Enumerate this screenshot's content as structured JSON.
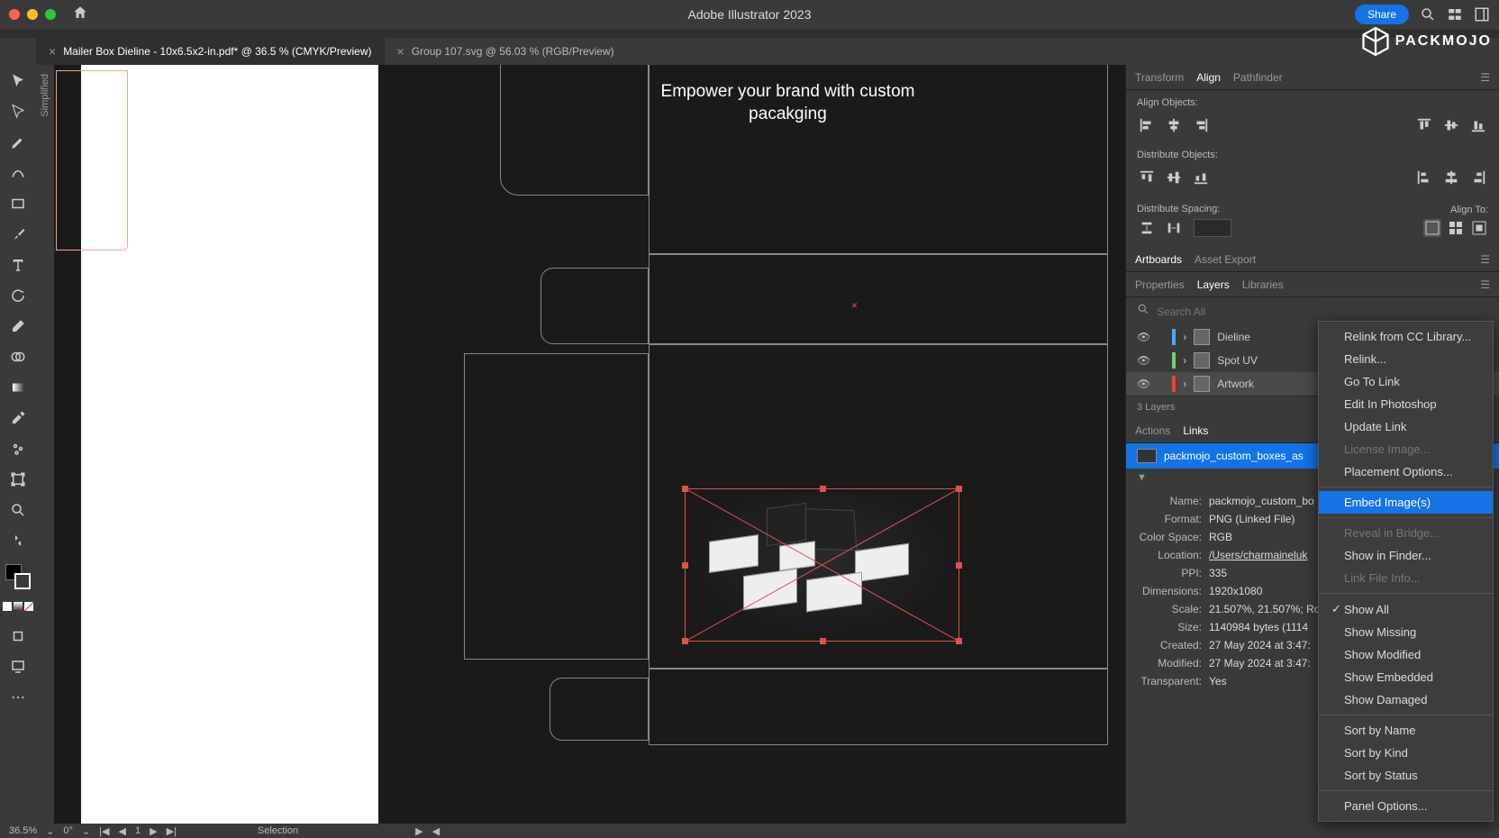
{
  "app": {
    "title": "Adobe Illustrator 2023",
    "share_label": "Share"
  },
  "watermark": "PACKMOJO",
  "tabs": [
    {
      "label": "Mailer Box Dieline - 10x6.5x2-in.pdf* @ 36.5 % (CMYK/Preview)",
      "active": true
    },
    {
      "label": "Group 107.svg @ 56.03 % (RGB/Preview)",
      "active": false
    }
  ],
  "sidebar_vert": "Simplified",
  "canvas": {
    "header_line1": "Empower your brand with custom",
    "header_line2": "pacakging"
  },
  "panels": {
    "tabs1": [
      "Transform",
      "Align",
      "Pathfinder"
    ],
    "tabs1_active": "Align",
    "align_objects_label": "Align Objects:",
    "distribute_objects_label": "Distribute Objects:",
    "distribute_spacing_label": "Distribute Spacing:",
    "align_to_label": "Align To:",
    "tabs2": [
      "Artboards",
      "Asset Export"
    ],
    "tabs2_active": "Artboards",
    "tabs3": [
      "Properties",
      "Layers",
      "Libraries"
    ],
    "tabs3_active": "Layers",
    "search_placeholder": "Search All",
    "layers": [
      {
        "name": "Dieline",
        "color": "#4aa8ff"
      },
      {
        "name": "Spot UV",
        "color": "#6bd65f"
      },
      {
        "name": "Artwork",
        "color": "#ff3b30",
        "selected": true
      }
    ],
    "layers_count": "3 Layers",
    "tabs4": [
      "Actions",
      "Links"
    ],
    "tabs4_active": "Links",
    "link_name": "packmojo_custom_boxes_as",
    "link_info": {
      "Name": "packmojo_custom_bo",
      "Format": "PNG (Linked File)",
      "Color Space": "RGB",
      "Location": "/Users/charmaineluk",
      "PPI": "335",
      "Dimensions": "1920x1080",
      "Scale": "21.507%, 21.507%; Ro",
      "Size": "1140984 bytes (1114",
      "Created": "27 May 2024 at 3:47:",
      "Modified": "27 May 2024 at 3:47:",
      "Transparent": "Yes"
    }
  },
  "context_menu": {
    "items": [
      {
        "label": "Relink from CC Library...",
        "type": "item"
      },
      {
        "label": "Relink...",
        "type": "item"
      },
      {
        "label": "Go To Link",
        "type": "item"
      },
      {
        "label": "Edit In Photoshop",
        "type": "item"
      },
      {
        "label": "Update Link",
        "type": "item"
      },
      {
        "label": "License Image...",
        "type": "item",
        "disabled": true
      },
      {
        "label": "Placement Options...",
        "type": "item"
      },
      {
        "type": "sep"
      },
      {
        "label": "Embed Image(s)",
        "type": "item",
        "highlight": true
      },
      {
        "type": "sep"
      },
      {
        "label": "Reveal in Bridge...",
        "type": "item",
        "disabled": true
      },
      {
        "label": "Show in Finder...",
        "type": "item"
      },
      {
        "label": "Link File Info...",
        "type": "item",
        "disabled": true
      },
      {
        "type": "sep"
      },
      {
        "label": "Show All",
        "type": "item",
        "checked": true
      },
      {
        "label": "Show Missing",
        "type": "item"
      },
      {
        "label": "Show Modified",
        "type": "item"
      },
      {
        "label": "Show Embedded",
        "type": "item"
      },
      {
        "label": "Show Damaged",
        "type": "item"
      },
      {
        "type": "sep"
      },
      {
        "label": "Sort by Name",
        "type": "item"
      },
      {
        "label": "Sort by Kind",
        "type": "item"
      },
      {
        "label": "Sort by Status",
        "type": "item"
      },
      {
        "type": "sep"
      },
      {
        "label": "Panel Options...",
        "type": "item"
      }
    ]
  },
  "statusbar": {
    "zoom": "36.5%",
    "rotation": "0°",
    "artboard": "1",
    "mode": "Selection"
  }
}
